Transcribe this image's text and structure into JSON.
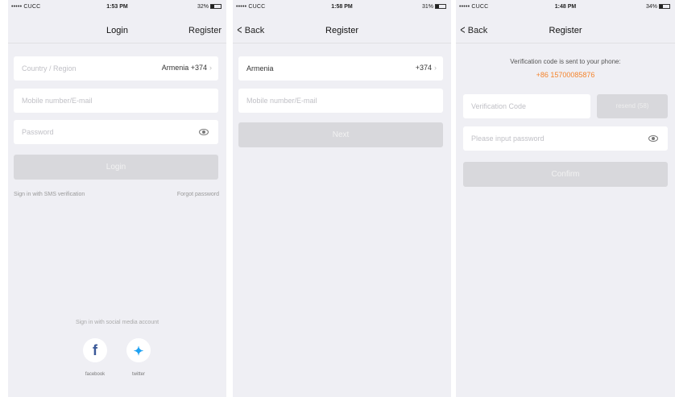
{
  "screens": [
    {
      "status": {
        "carrier": "••••• CUCC",
        "time": "1:53 PM",
        "battery": "32%"
      },
      "nav": {
        "title": "Login",
        "right": "Register"
      },
      "country": {
        "placeholder": "Country / Region",
        "value": "Armenia +374"
      },
      "mobile_placeholder": "Mobile number/E-mail",
      "password_placeholder": "Password",
      "login_button": "Login",
      "sms_link": "Sign in with SMS verification",
      "forgot_link": "Forgot password",
      "social_caption": "Sign in with social media account",
      "facebook_label": "facebook",
      "twitter_label": "twitter"
    },
    {
      "status": {
        "carrier": "••••• CUCC",
        "time": "1:58 PM",
        "battery": "31%"
      },
      "nav": {
        "back": "Back",
        "title": "Register"
      },
      "country": {
        "name": "Armenia",
        "code": "+374"
      },
      "mobile_placeholder": "Mobile number/E-mail",
      "next_button": "Next"
    },
    {
      "status": {
        "carrier": "••••• CUCC",
        "time": "1:48 PM",
        "battery": "34%"
      },
      "nav": {
        "back": "Back",
        "title": "Register"
      },
      "verify_message": "Verification code is sent to your phone:",
      "phone": "+86 15700085876",
      "code_placeholder": "Verification Code",
      "resend_label": "resend (58)",
      "password_placeholder": "Please input password",
      "confirm_button": "Confirm"
    }
  ],
  "colors": {
    "accent_orange": "#f5842c",
    "background": "#efeff4",
    "disabled_button": "#d8d8dc"
  }
}
